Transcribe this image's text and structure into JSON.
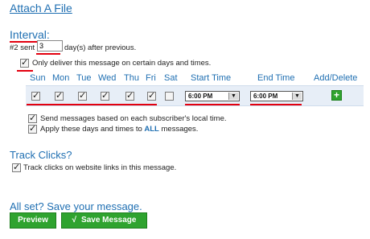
{
  "attach_link": "Attach A File",
  "interval": {
    "heading": "Interval:",
    "prefix": "#2 sent",
    "days_value": "3",
    "suffix": "day(s) after previous."
  },
  "only_deliver": {
    "label": "Only deliver this message on certain days and times.",
    "checked": true
  },
  "schedule": {
    "days": [
      "Sun",
      "Mon",
      "Tue",
      "Wed",
      "Thu",
      "Fri",
      "Sat"
    ],
    "days_checked": [
      true,
      true,
      true,
      true,
      true,
      true,
      false
    ],
    "start_time_header": "Start Time",
    "end_time_header": "End Time",
    "add_delete_header": "Add/Delete",
    "start_time": "6:00 PM",
    "end_time": "6:00 PM"
  },
  "local_time": {
    "label": "Send messages based on each subscriber's local time.",
    "checked": true
  },
  "apply_all": {
    "label_pre": "Apply these days and times to ",
    "label_bold": "ALL",
    "label_post": " messages.",
    "checked": true
  },
  "track": {
    "heading": "Track Clicks?",
    "label": "Track clicks on website links in this message.",
    "checked": true
  },
  "save": {
    "heading": "All set? Save your message.",
    "preview_label": "Preview",
    "save_label": "Save Message",
    "check_glyph": "√"
  },
  "colors": {
    "accent": "#1f6fb2",
    "button": "#2fa32f",
    "underline": "#e3000f"
  }
}
